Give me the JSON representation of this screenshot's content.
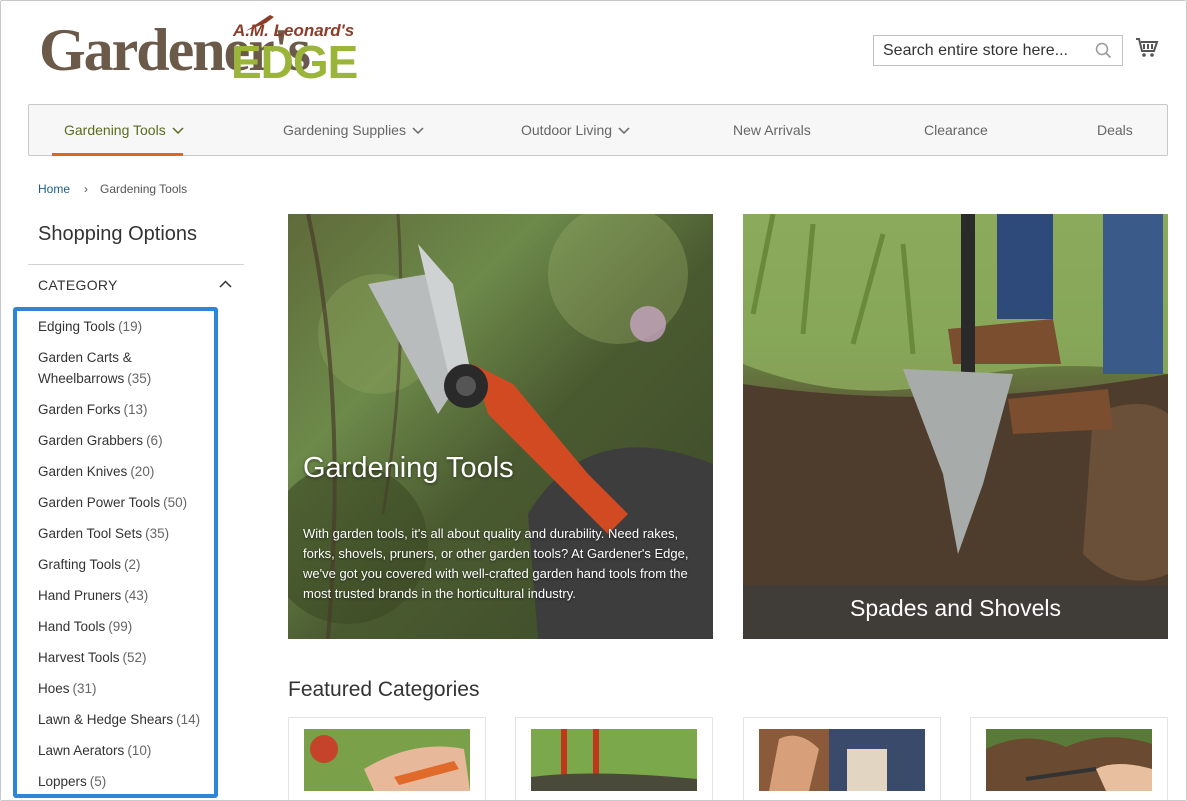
{
  "header": {
    "logo_main": "Gardener's",
    "logo_brand": "A.M. Leonard's",
    "logo_edge": "EDGE",
    "search_placeholder": "Search entire store here..."
  },
  "nav": {
    "items": [
      {
        "label": "Gardening Tools",
        "active": true,
        "dropdown": true
      },
      {
        "label": "Gardening Supplies",
        "active": false,
        "dropdown": true
      },
      {
        "label": "Outdoor Living",
        "active": false,
        "dropdown": true
      },
      {
        "label": "New Arrivals",
        "active": false,
        "dropdown": false
      },
      {
        "label": "Clearance",
        "active": false,
        "dropdown": false
      },
      {
        "label": "Deals",
        "active": false,
        "dropdown": false
      }
    ]
  },
  "breadcrumb": {
    "home": "Home",
    "current": "Gardening Tools"
  },
  "sidebar": {
    "title": "Shopping Options",
    "category_heading": "CATEGORY",
    "categories": [
      {
        "name": "Edging Tools",
        "count": "(19)"
      },
      {
        "name": "Garden Carts & Wheelbarrows",
        "count": "(35)"
      },
      {
        "name": "Garden Forks",
        "count": "(13)"
      },
      {
        "name": "Garden Grabbers",
        "count": "(6)"
      },
      {
        "name": "Garden Knives",
        "count": "(20)"
      },
      {
        "name": "Garden Power Tools",
        "count": "(50)"
      },
      {
        "name": "Garden Tool Sets",
        "count": "(35)"
      },
      {
        "name": "Grafting Tools",
        "count": "(2)"
      },
      {
        "name": "Hand Pruners",
        "count": "(43)"
      },
      {
        "name": "Hand Tools",
        "count": "(99)"
      },
      {
        "name": "Harvest Tools",
        "count": "(52)"
      },
      {
        "name": "Hoes",
        "count": "(31)"
      },
      {
        "name": "Lawn & Hedge Shears",
        "count": "(14)"
      },
      {
        "name": "Lawn Aerators",
        "count": "(10)"
      },
      {
        "name": "Loppers",
        "count": "(5)"
      }
    ]
  },
  "hero": {
    "tile1_title": "Gardening Tools",
    "tile1_desc": "With garden tools, it's all about quality and durability. Need rakes, forks, shovels, pruners, or other garden tools? At Gardener's Edge, we've got you covered with well-crafted garden hand tools from the most trusted brands in the horticultural industry.",
    "tile2_title": "Spades and Shovels"
  },
  "featured": {
    "title": "Featured Categories"
  },
  "colors": {
    "accent_orange": "#e0661d",
    "active_nav": "#5a6b1d",
    "highlight_box": "#2f85d6",
    "logo_brown": "#6b5a4a",
    "logo_green": "#9bb53a"
  }
}
